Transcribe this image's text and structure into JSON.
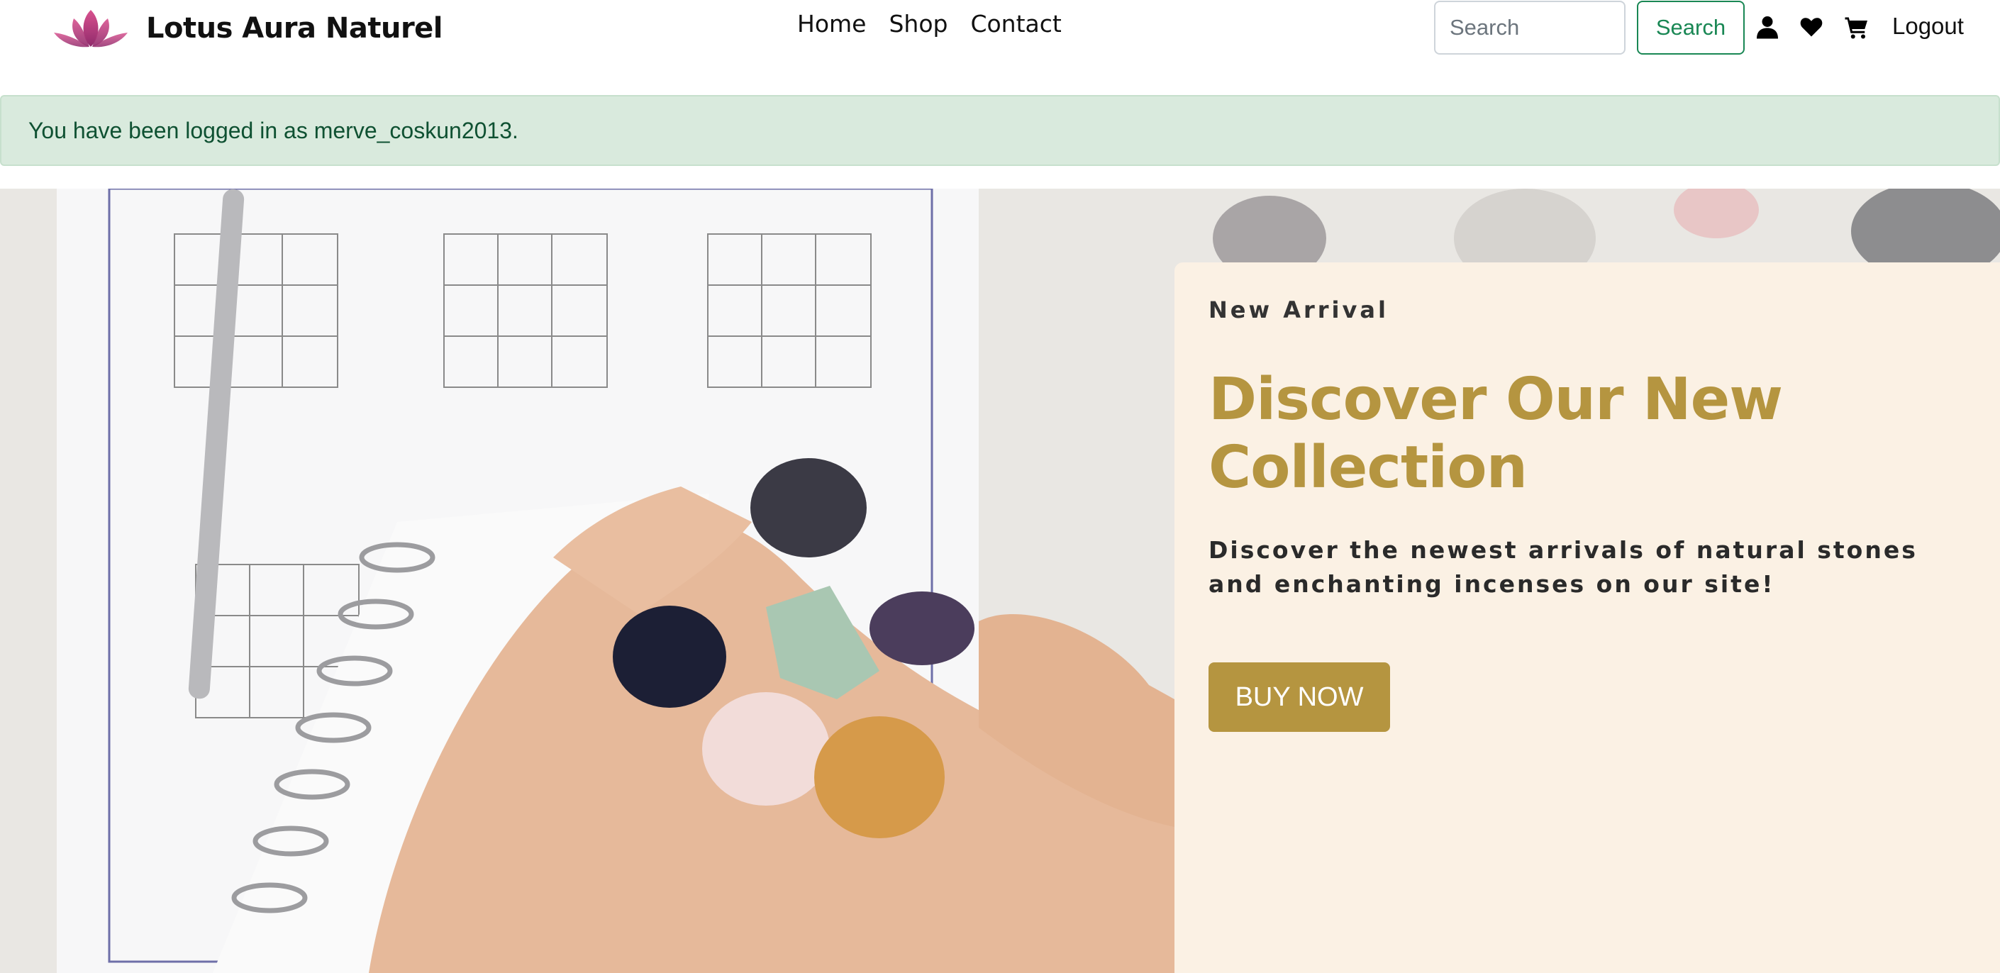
{
  "brand": {
    "name": "Lotus Aura Naturel",
    "logo_icon": "lotus-icon",
    "logo_color": "#c2367a"
  },
  "nav": {
    "links": [
      {
        "label": "Home"
      },
      {
        "label": "Shop"
      },
      {
        "label": "Contact"
      }
    ]
  },
  "search": {
    "placeholder": "Search",
    "value": "",
    "button_label": "Search"
  },
  "header_icons": {
    "user": "user-icon",
    "wishlist": "heart-icon",
    "cart": "cart-icon"
  },
  "logout_label": "Logout",
  "alert": {
    "message": "You have been logged in as merve_coskun2013.",
    "color": "#d9eadd"
  },
  "hero": {
    "eyebrow": "New Arrival",
    "title": "Discover Our New Collection",
    "description": "Discover the newest arrivals of natural stones and enchanting incenses on our site!",
    "button_label": "BUY NOW",
    "accent_color": "#b59540",
    "card_color": "#fbf1e4"
  }
}
